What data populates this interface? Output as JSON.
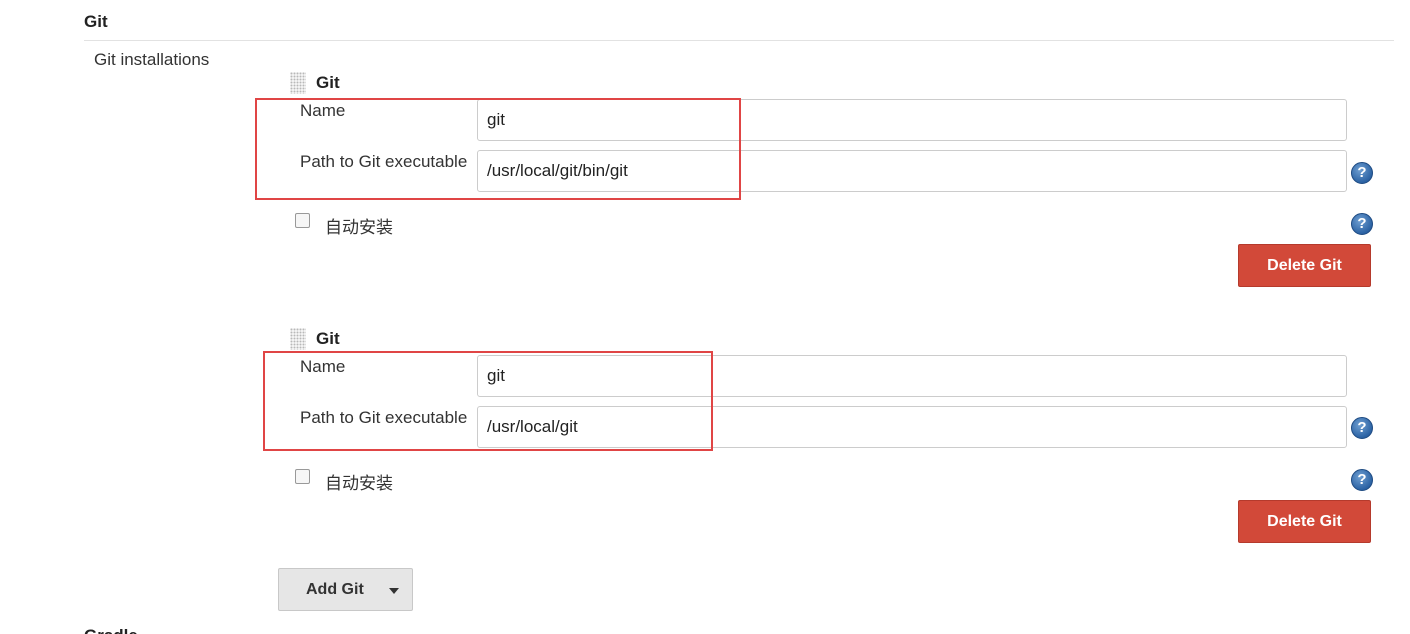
{
  "section": {
    "title": "Git",
    "installations_label": "Git installations",
    "next_section_title": "Gradle"
  },
  "installations": [
    {
      "title": "Git",
      "name_label": "Name",
      "name_value": "git",
      "path_label": "Path to Git executable",
      "path_value": "/usr/local/git/bin/git",
      "auto_install_label": "自动安装",
      "delete_label": "Delete Git"
    },
    {
      "title": "Git",
      "name_label": "Name",
      "name_value": "git",
      "path_label": "Path to Git executable",
      "path_value": "/usr/local/git",
      "auto_install_label": "自动安装",
      "delete_label": "Delete Git"
    }
  ],
  "add_button": {
    "label": "Add Git"
  },
  "help_icon_glyph": "?",
  "colors": {
    "delete": "#d24939",
    "highlight": "#e04545",
    "help": "#2c63a4"
  }
}
